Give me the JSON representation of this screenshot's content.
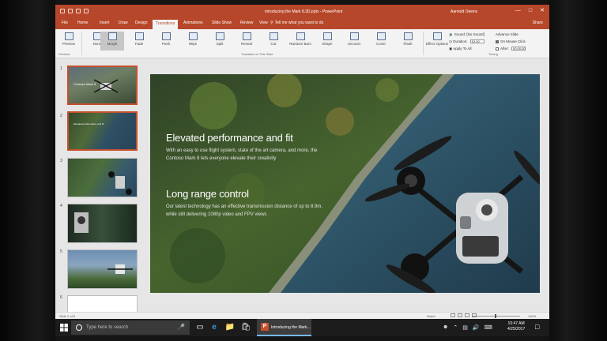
{
  "app": {
    "title": "Introducing the Mark 8.3D.pptx - PowerPoint",
    "user": "Aarnold Owens",
    "window_controls": [
      "—",
      "□",
      "✕"
    ]
  },
  "tabs": [
    "File",
    "Home",
    "Insert",
    "Draw",
    "Design",
    "Transitions",
    "Animations",
    "Slide Show",
    "Review",
    "View"
  ],
  "active_tab": "Transitions",
  "tell_me": "Tell me what you want to do",
  "share": "Share",
  "ribbon": {
    "preview_label": "Preview",
    "transitions": [
      "None",
      "Morph",
      "Fade",
      "Push",
      "Wipe",
      "Split",
      "Reveal",
      "Cut",
      "Random Bars",
      "Shape",
      "Uncover",
      "Cover",
      "Flash"
    ],
    "selected_transition": "Morph",
    "effect_options": "Effect Options",
    "sound_label": "Sound:",
    "sound_value": "[No Sound]",
    "duration_label": "Duration:",
    "duration_value": "02.00",
    "apply_all": "Apply To All",
    "advance_label": "Advance Slide",
    "on_click": "On Mouse Click",
    "after_label": "After:",
    "after_value": "00:00.00",
    "groups": [
      "Preview",
      "Transition to This Slide",
      "Timing"
    ]
  },
  "thumbnails": [
    {
      "number": "1",
      "text": "Contoso Mark 8"
    },
    {
      "number": "2",
      "text": "Elevated performance and fit"
    },
    {
      "number": "3",
      "text": ""
    },
    {
      "number": "4",
      "text": ""
    },
    {
      "number": "5",
      "text": ""
    },
    {
      "number": "6",
      "text": ""
    }
  ],
  "slide": {
    "heading1": "Elevated performance and fit",
    "body1": "With an easy to use flight system, state of the art camera, and more, the Contoso Mark 8 lets everyone elevate their creativity",
    "heading2": "Long range control",
    "body2": "Our latest technology has an effective transmission distance of up to 8.9m, while still delivering 1080p video and FPV views"
  },
  "status": {
    "slide_info": "Slide 2 of 6",
    "notes": "Notes",
    "zoom": "100%"
  },
  "taskbar": {
    "search_placeholder": "Type here to search",
    "ppt_label": "Introducing the Mark...",
    "time": "10:47 AM",
    "date": "4/25/2017"
  },
  "colors": {
    "accent": "#b7472a",
    "selected_thumb": "#c6502c",
    "taskbar": "#1c1c1c"
  }
}
